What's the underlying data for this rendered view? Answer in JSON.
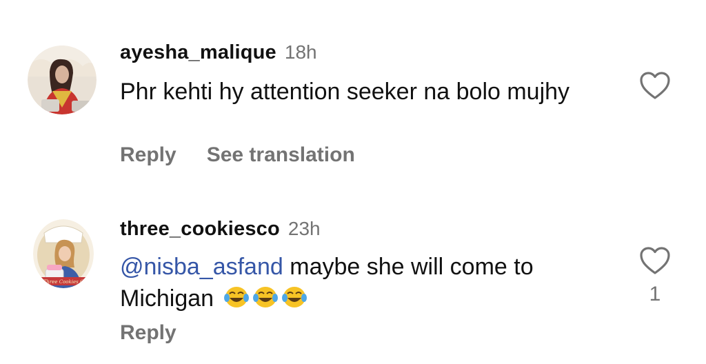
{
  "comments": [
    {
      "username": "ayesha_malique",
      "time": "18h",
      "text": "Phr kehti hy attention seeker na bolo mujhy",
      "actions": {
        "reply": "Reply",
        "see_translation": "See translation"
      },
      "like_icon": "heart-outline-icon"
    },
    {
      "username": "three_cookiesco",
      "time": "23h",
      "mention": "@nisba_asfand",
      "text": " maybe she will come to Michigan",
      "emojis": [
        "😂",
        "😂",
        "😂"
      ],
      "actions": {
        "reply": "Reply"
      },
      "like_icon": "heart-outline-icon",
      "like_count": "1",
      "avatar_text": "Three Cookies C"
    }
  ],
  "colors": {
    "text": "#111111",
    "secondary": "#737373",
    "mention": "#3556a7"
  }
}
